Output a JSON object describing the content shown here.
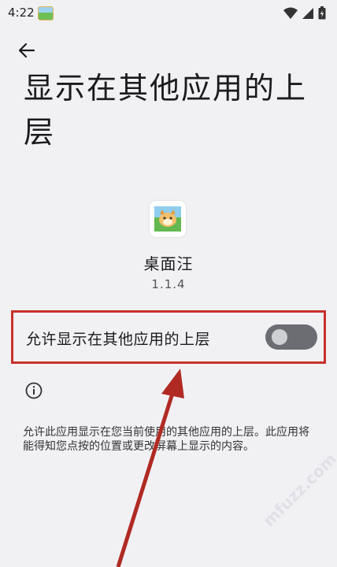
{
  "status_bar": {
    "time": "4:22",
    "icons": [
      "app-notification-icon",
      "wifi-icon",
      "cell-signal-icon",
      "battery-icon"
    ]
  },
  "header": {
    "back_icon": "arrow-left-icon",
    "title": "显示在其他应用的上层"
  },
  "app": {
    "name": "桌面汪",
    "version": "1.1.4"
  },
  "permission": {
    "label": "允许显示在其他应用的上层",
    "enabled": false
  },
  "info": {
    "icon": "info-icon",
    "description": "允许此应用显示在您当前使用的其他应用的上层。此应用将能得知您点按的位置或更改屏幕上显示的内容。"
  },
  "watermark": "mfuzz.com",
  "colors": {
    "background": "#f1f1f4",
    "highlight_border": "#c8312a",
    "annotation_arrow": "#b02a23",
    "toggle_track": "#6b6d73"
  }
}
